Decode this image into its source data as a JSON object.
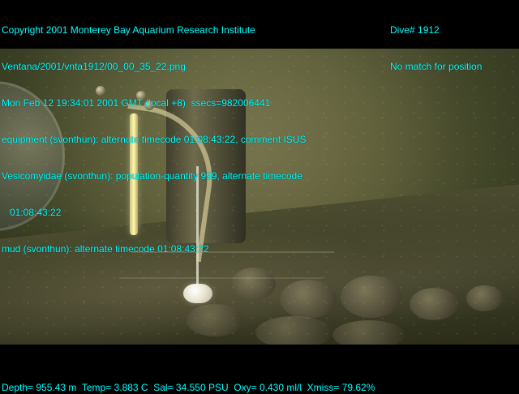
{
  "overlay": {
    "top_left_lines": [
      "Copyright 2001 Monterey Bay Aquarium Research Institute",
      "Ventana/2001/vnta1912/00_00_35_22.png",
      "Mon Feb 12 19:34:01 2001 GMT (local +8)  ssecs=982006441",
      "equipment (svonthun): alternate timecode 01:08:43:22, comment ISUS",
      "Vesicomyidae (svonthun): population-quantity 999, alternate timecode",
      "   01:08:43:22",
      "mud (svonthun): alternate timecode 01:08:43:22"
    ],
    "top_right_lines": [
      "Dive# 1912",
      "No match for position"
    ],
    "bottom_line": "Depth= 955.43 m  Temp= 3.883 C  Sal= 34.550 PSU  Oxy= 0.430 ml/l  Xmiss= 79.62%"
  },
  "colors": {
    "overlay_text": "#00ffff",
    "frame": "#000000"
  }
}
